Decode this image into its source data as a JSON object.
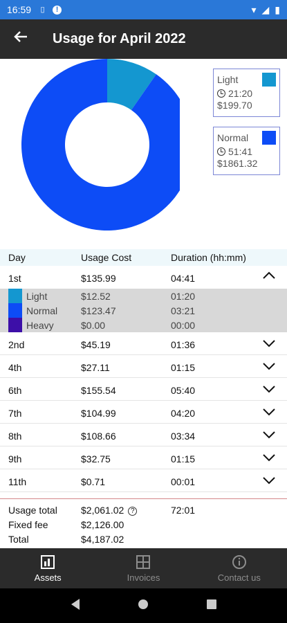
{
  "status": {
    "time": "16:59"
  },
  "header": {
    "title": "Usage for April 2022"
  },
  "chart_data": {
    "type": "pie",
    "categories": [
      "Light",
      "Normal"
    ],
    "values": [
      199.7,
      1861.32
    ],
    "durations": [
      "21:20",
      "51:41"
    ],
    "costs": [
      "$199.70",
      "$1861.32"
    ],
    "colors": [
      "#1497d0",
      "#0d4cf6"
    ],
    "donut": true
  },
  "table": {
    "headers": {
      "day": "Day",
      "cost": "Usage Cost",
      "duration": "Duration (hh:mm)"
    },
    "expanded": {
      "day": "1st",
      "cost": "$135.99",
      "duration": "04:41",
      "breakdown": [
        {
          "name": "Light",
          "cost": "$12.52",
          "duration": "01:20",
          "color": "#1497d0"
        },
        {
          "name": "Normal",
          "cost": "$123.47",
          "duration": "03:21",
          "color": "#0d4cf6"
        },
        {
          "name": "Heavy",
          "cost": "$0.00",
          "duration": "00:00",
          "color": "#3d0fa8"
        }
      ]
    },
    "rows": [
      {
        "day": "2nd",
        "cost": "$45.19",
        "duration": "01:36"
      },
      {
        "day": "4th",
        "cost": "$27.11",
        "duration": "01:15"
      },
      {
        "day": "6th",
        "cost": "$155.54",
        "duration": "05:40"
      },
      {
        "day": "7th",
        "cost": "$104.99",
        "duration": "04:20"
      },
      {
        "day": "8th",
        "cost": "$108.66",
        "duration": "03:34"
      },
      {
        "day": "9th",
        "cost": "$32.75",
        "duration": "01:15"
      },
      {
        "day": "11th",
        "cost": "$0.71",
        "duration": "00:01"
      }
    ]
  },
  "totals": {
    "usage_label": "Usage total",
    "usage_cost": "$2,061.02",
    "usage_duration": "72:01",
    "fixed_label": "Fixed fee",
    "fixed_cost": "$2,126.00",
    "total_label": "Total",
    "total_cost": "$4,187.02"
  },
  "nav": {
    "assets": "Assets",
    "invoices": "Invoices",
    "contact": "Contact us"
  }
}
